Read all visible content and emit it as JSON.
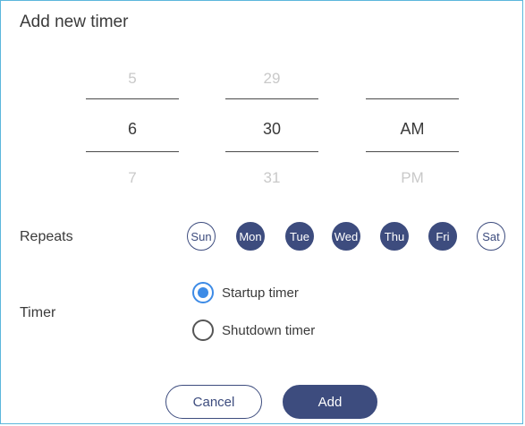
{
  "dialog": {
    "title": "Add new timer"
  },
  "time_picker": {
    "hour": {
      "prev": "5",
      "current": "6",
      "next": "7"
    },
    "minute": {
      "prev": "29",
      "current": "30",
      "next": "31"
    },
    "period": {
      "prev": "",
      "current": "AM",
      "next": "PM"
    }
  },
  "repeats": {
    "label": "Repeats",
    "days": [
      {
        "label": "Sun",
        "selected": false
      },
      {
        "label": "Mon",
        "selected": true
      },
      {
        "label": "Tue",
        "selected": true
      },
      {
        "label": "Wed",
        "selected": true
      },
      {
        "label": "Thu",
        "selected": true
      },
      {
        "label": "Fri",
        "selected": true
      },
      {
        "label": "Sat",
        "selected": false
      }
    ]
  },
  "timer": {
    "label": "Timer",
    "options": [
      {
        "label": "Startup timer",
        "checked": true
      },
      {
        "label": "Shutdown timer",
        "checked": false
      }
    ]
  },
  "buttons": {
    "cancel": "Cancel",
    "add": "Add"
  },
  "colors": {
    "accent": "#3d4c7e",
    "radio_active": "#3d8be6",
    "border": "#5bb7dc"
  }
}
